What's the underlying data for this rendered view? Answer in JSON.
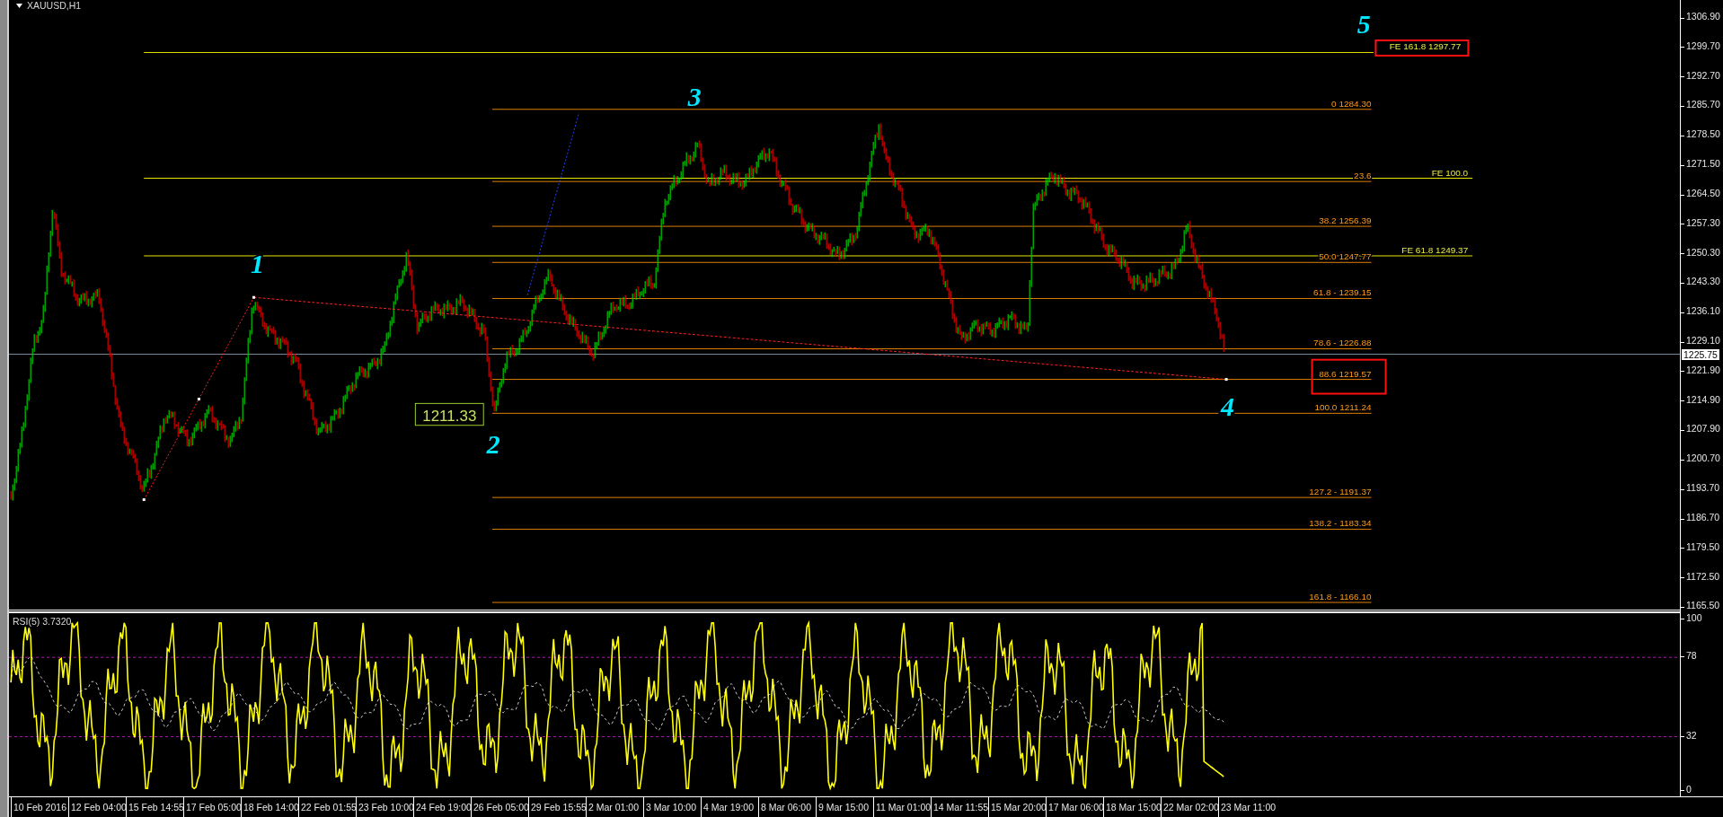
{
  "chart_title": "XAUUSD,H1",
  "price_axis": {
    "labels": [
      "1306.90",
      "1299.70",
      "1292.70",
      "1285.70",
      "1278.50",
      "1271.50",
      "1264.50",
      "1257.30",
      "1250.30",
      "1243.30",
      "1236.10",
      "1229.10",
      "1221.90",
      "1214.90",
      "1207.90",
      "1200.70",
      "1193.70",
      "1186.70",
      "1179.50",
      "1172.50",
      "1165.50"
    ],
    "current_price": "1225.75"
  },
  "fe_levels": [
    {
      "label": "FE 161.8 1297.77",
      "highlighted": true
    },
    {
      "label": "FE 100.0",
      "highlighted": false
    },
    {
      "label": "FE 61.8 1249.37",
      "highlighted": false
    }
  ],
  "fib_levels": [
    {
      "label": "0 1284.30",
      "highlighted": false
    },
    {
      "label": "23.6",
      "highlighted": false
    },
    {
      "label": "38.2 1256.39",
      "highlighted": false
    },
    {
      "label": "50.0 1247.77",
      "highlighted": false
    },
    {
      "label": "61.8 - 1239.15",
      "highlighted": false
    },
    {
      "label": "78.6 - 1226.88",
      "highlighted": false
    },
    {
      "label": "88.6 1219.57",
      "highlighted": true
    },
    {
      "label": "100.0 1211.24",
      "highlighted": false
    },
    {
      "label": "127.2 - 1191.37",
      "highlighted": false
    },
    {
      "label": "138.2 - 1183.34",
      "highlighted": false
    },
    {
      "label": "161.8 -  1166.10",
      "highlighted": false
    }
  ],
  "wave_labels": [
    "1",
    "2",
    "3",
    "4",
    "5"
  ],
  "price_callout": "1211.33",
  "rsi": {
    "label": "RSI(5) 3.7320",
    "axis_labels": [
      "100",
      "78",
      "32",
      "0"
    ]
  },
  "time_axis": [
    "10 Feb 2016",
    "12 Feb 04:00",
    "15 Feb 14:55",
    "17 Feb 05:00",
    "18 Feb 14:00",
    "22 Feb 01:55",
    "23 Feb 10:00",
    "24 Feb 19:00",
    "26 Feb 05:00",
    "29 Feb 15:55",
    "2 Mar 01:00",
    "3 Mar 10:00",
    "4 Mar 19:00",
    "8 Mar 06:00",
    "9 Mar 15:00",
    "11 Mar 01:00",
    "14 Mar 11:55",
    "15 Mar 20:00",
    "17 Mar 06:00",
    "18 Mar 15:00",
    "22 Mar 02:00",
    "23 Mar 11:00"
  ]
}
